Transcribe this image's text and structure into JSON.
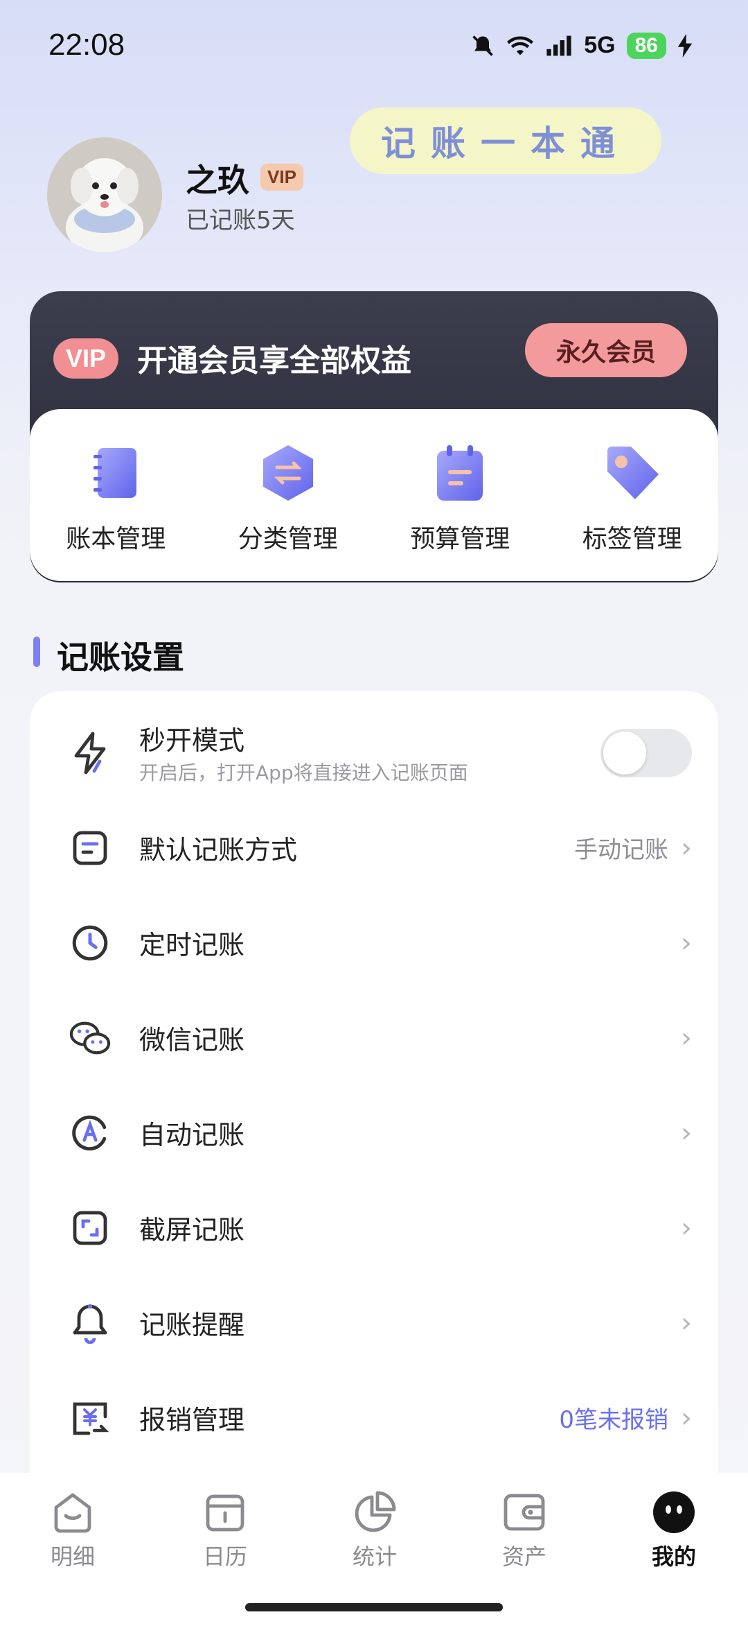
{
  "status_bar": {
    "time": "22:08",
    "network": "5G",
    "battery": "86"
  },
  "profile": {
    "name": "之玖",
    "vip_badge": "VIP",
    "days_text": "已记账5天",
    "slogan": "记账一本通"
  },
  "vip_banner": {
    "pill": "VIP",
    "text": "开通会员享全部权益",
    "button": "永久会员"
  },
  "quick_actions": [
    {
      "label": "账本管理",
      "icon": "ledger-book-icon"
    },
    {
      "label": "分类管理",
      "icon": "category-swap-icon"
    },
    {
      "label": "预算管理",
      "icon": "budget-notepad-icon"
    },
    {
      "label": "标签管理",
      "icon": "tag-icon"
    }
  ],
  "section": {
    "title": "记账设置"
  },
  "settings": [
    {
      "title": "秒开模式",
      "subtitle": "开启后，打开App将直接进入记账页面",
      "icon": "lightning-icon",
      "toggle": false
    },
    {
      "title": "默认记账方式",
      "value": "手动记账",
      "icon": "document-icon"
    },
    {
      "title": "定时记账",
      "icon": "clock-icon"
    },
    {
      "title": "微信记账",
      "icon": "wechat-icon"
    },
    {
      "title": "自动记账",
      "icon": "auto-a-icon"
    },
    {
      "title": "截屏记账",
      "icon": "screenshot-icon"
    },
    {
      "title": "记账提醒",
      "icon": "bell-icon"
    },
    {
      "title": "报销管理",
      "value": "0笔未报销",
      "icon": "reimburse-icon"
    }
  ],
  "tabs": [
    {
      "label": "明细",
      "icon": "details-icon",
      "active": false
    },
    {
      "label": "日历",
      "icon": "calendar-icon",
      "active": false
    },
    {
      "label": "统计",
      "icon": "pie-chart-icon",
      "active": false
    },
    {
      "label": "资产",
      "icon": "wallet-icon",
      "active": false
    },
    {
      "label": "我的",
      "icon": "profile-face-icon",
      "active": true
    }
  ],
  "colors": {
    "accent": "#7b80f2",
    "vip_pink": "#f28f93",
    "vip_dark": "#2c2d3a"
  }
}
